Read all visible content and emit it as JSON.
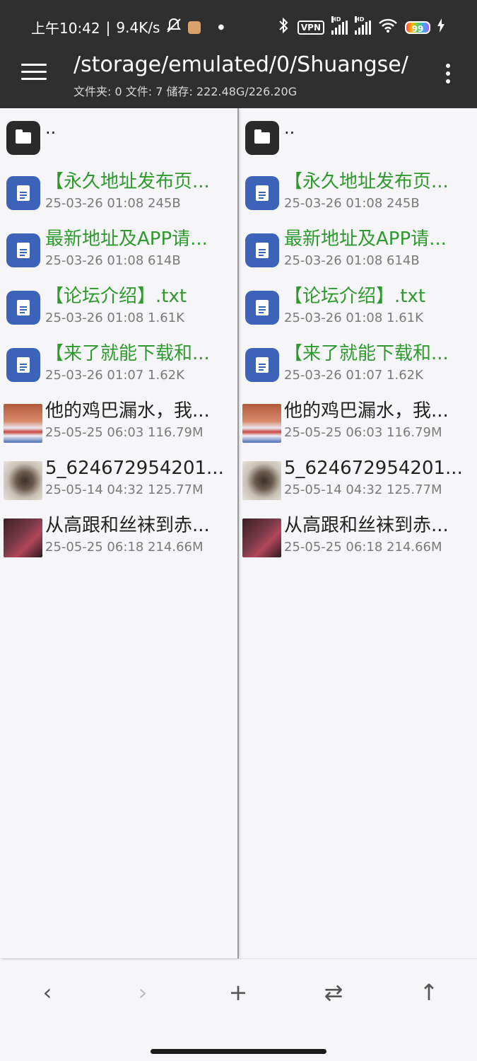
{
  "status_bar": {
    "time": "上午10:42",
    "separator": "|",
    "net_speed": "9.4K/s",
    "vpn": "VPN",
    "hd1": "HD",
    "hd2": "HD",
    "battery": "99",
    "icons": [
      "silent-bell-icon",
      "app-notification-icon",
      "dot-icon",
      "bluetooth-icon",
      "vpn-icon",
      "signal-icon",
      "signal-icon",
      "wifi-icon",
      "battery-icon",
      "charging-icon"
    ]
  },
  "toolbar": {
    "path": "/storage/emulated/0/Shuangse/",
    "stats": "文件夹: 0  文件: 7  储存: 222.48G/226.20G"
  },
  "panes": {
    "left": {
      "parent_label": "..",
      "files": [
        {
          "name": "【永久地址发布页...",
          "meta": "25-03-26 01:08  245B",
          "kind": "text"
        },
        {
          "name": "最新地址及APP请...",
          "meta": "25-03-26 01:08  614B",
          "kind": "text"
        },
        {
          "name": "【论坛介绍】.txt",
          "meta": "25-03-26 01:08  1.61K",
          "kind": "text"
        },
        {
          "name": "【来了就能下载和...",
          "meta": "25-03-26 01:07  1.62K",
          "kind": "text"
        },
        {
          "name": "他的鸡巴漏水，我...",
          "meta": "25-05-25 06:03  116.79M",
          "kind": "video"
        },
        {
          "name": "5_624672954201...",
          "meta": "25-05-14 04:32  125.77M",
          "kind": "video"
        },
        {
          "name": "从高跟和丝袜到赤...",
          "meta": "25-05-25 06:18  214.66M",
          "kind": "video"
        }
      ]
    },
    "right": {
      "parent_label": "..",
      "files": [
        {
          "name": "【永久地址发布页...",
          "meta": "25-03-26 01:08  245B",
          "kind": "text"
        },
        {
          "name": "最新地址及APP请...",
          "meta": "25-03-26 01:08  614B",
          "kind": "text"
        },
        {
          "name": "【论坛介绍】.txt",
          "meta": "25-03-26 01:08  1.61K",
          "kind": "text"
        },
        {
          "name": "【来了就能下载和...",
          "meta": "25-03-26 01:07  1.62K",
          "kind": "text"
        },
        {
          "name": "他的鸡巴漏水，我...",
          "meta": "25-05-25 06:03  116.79M",
          "kind": "video"
        },
        {
          "name": "5_624672954201...",
          "meta": "25-05-14 04:32  125.77M",
          "kind": "video"
        },
        {
          "name": "从高跟和丝袜到赤...",
          "meta": "25-05-25 06:18  214.66M",
          "kind": "video"
        }
      ]
    }
  },
  "bottom_nav": {
    "back": "‹",
    "forward": "›",
    "add": "+",
    "swap": "⇄",
    "up": "↑"
  },
  "colors": {
    "toolbar_bg": "#2f2f2f",
    "text_file_name": "#2e9a2e",
    "doc_icon_bg": "#3c63b8",
    "folder_icon_bg": "#2a2a2a"
  }
}
